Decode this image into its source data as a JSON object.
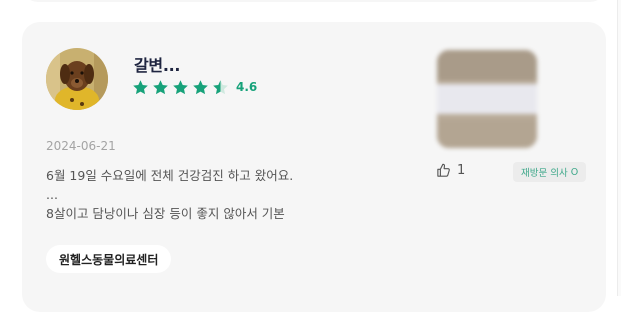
{
  "review": {
    "author_name": "갈변...",
    "rating_value": 4.6,
    "rating_text": "4.6",
    "stars": [
      "full",
      "full",
      "full",
      "full",
      "half"
    ],
    "date": "2024-06-21",
    "body_lines": [
      "6월 19일 수요일에 전체 건강검진 하고 왔어요.",
      "...",
      "8살이고 담낭이나 심장 등이 좋지 않아서 기본"
    ],
    "hospital_tag": "원헬스동물의료센터",
    "like_count": "1",
    "revisit_badge": "재방문 의사",
    "revisit_mark": "O"
  },
  "icons": {
    "avatar": "dog-avatar-image",
    "star": "star-icon",
    "like": "thumbs-up-icon",
    "thumbnail": "blurred-review-photo"
  },
  "colors": {
    "star": "#17a27a",
    "rating": "#17a27a",
    "name": "#1f2540",
    "card_bg": "#f6f6f6",
    "badge_text": "#3ea88a"
  }
}
